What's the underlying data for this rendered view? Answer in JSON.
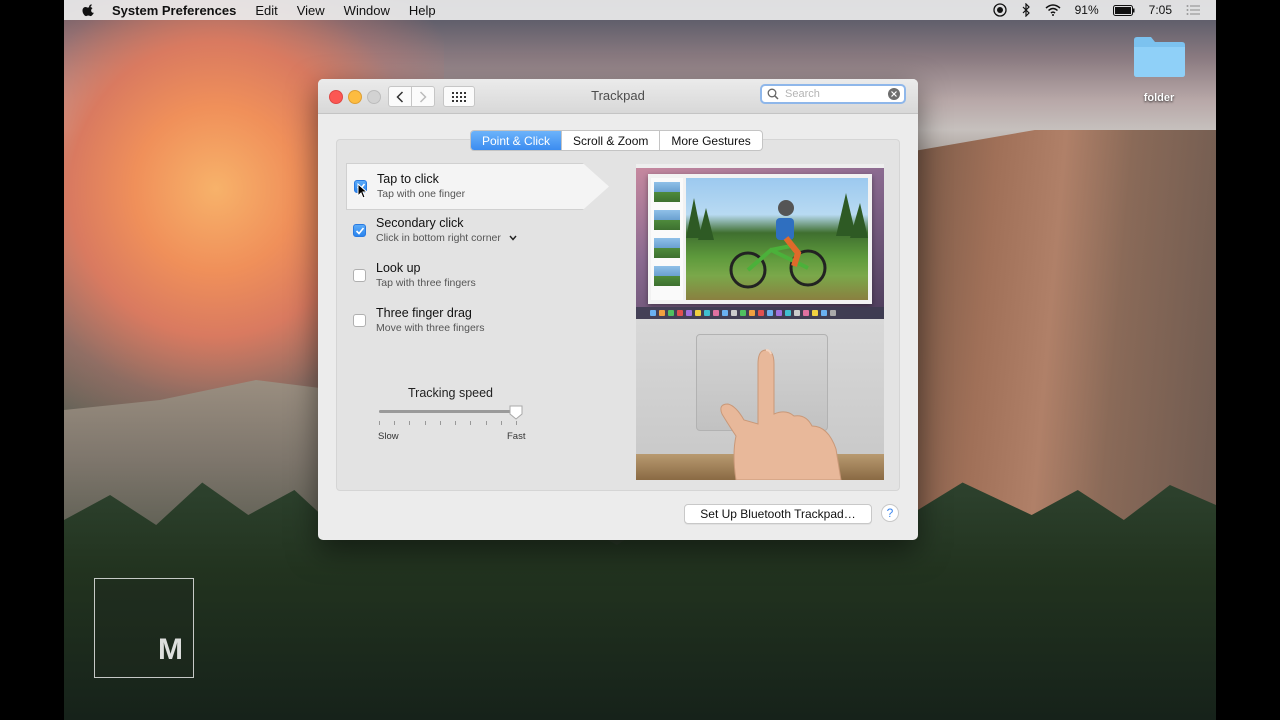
{
  "menubar": {
    "app_name": "System Preferences",
    "menus": [
      "Edit",
      "View",
      "Window",
      "Help"
    ],
    "battery": "91%",
    "clock": "7:05"
  },
  "desktop": {
    "folder_label": "folder",
    "watermark_letter": "M"
  },
  "window": {
    "title": "Trackpad",
    "search_placeholder": "Search",
    "tabs": [
      {
        "label": "Point & Click",
        "active": true
      },
      {
        "label": "Scroll & Zoom",
        "active": false
      },
      {
        "label": "More Gestures",
        "active": false
      }
    ],
    "options": [
      {
        "title": "Tap to click",
        "subtitle": "Tap with one finger",
        "checked": true,
        "selected": true
      },
      {
        "title": "Secondary click",
        "subtitle": "Click in bottom right corner",
        "checked": true,
        "selected": false
      },
      {
        "title": "Look up",
        "subtitle": "Tap with three fingers",
        "checked": false,
        "selected": false
      },
      {
        "title": "Three finger drag",
        "subtitle": "Move with three fingers",
        "checked": false,
        "selected": false
      }
    ],
    "tracking": {
      "title": "Tracking speed",
      "min_label": "Slow",
      "max_label": "Fast",
      "value_fraction": 1.0,
      "tick_count": 10
    },
    "bluetooth_button": "Set Up Bluetooth Trackpad…",
    "help_button": "?"
  },
  "colors": {
    "accent": "#3b8cf0",
    "close": "#fc5753",
    "minimize": "#fdbc40"
  }
}
